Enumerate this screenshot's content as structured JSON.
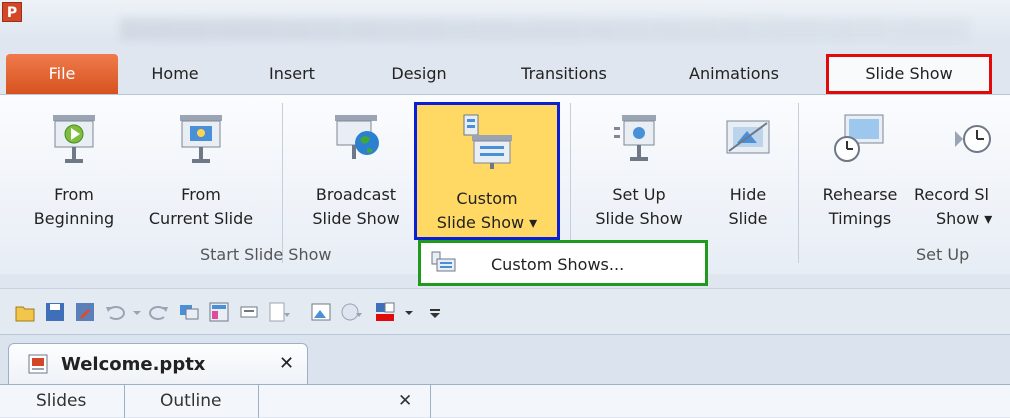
{
  "app": {
    "icon_letter": "P"
  },
  "tabs": [
    {
      "label": "File"
    },
    {
      "label": "Home"
    },
    {
      "label": "Insert"
    },
    {
      "label": "Design"
    },
    {
      "label": "Transitions"
    },
    {
      "label": "Animations"
    },
    {
      "label": "Slide Show"
    }
  ],
  "ribbon": {
    "buttons": [
      {
        "line1": "From",
        "line2": "Beginning"
      },
      {
        "line1": "From",
        "line2": "Current Slide"
      },
      {
        "line1": "Broadcast",
        "line2": "Slide Show"
      },
      {
        "line1": "Custom",
        "line2": "Slide Show ▾"
      },
      {
        "line1": "Set Up",
        "line2": "Slide Show"
      },
      {
        "line1": "Hide",
        "line2": "Slide"
      },
      {
        "line1": "Rehearse",
        "line2": "Timings"
      },
      {
        "line1": "Record Sl",
        "line2": "Show ▾"
      }
    ],
    "groups": {
      "start": "Start Slide Show",
      "setup": "Set Up"
    }
  },
  "dropdown": {
    "item": "Custom Shows..."
  },
  "document_tab": {
    "name": "Welcome.pptx",
    "close": "✕"
  },
  "panes": {
    "slides": "Slides",
    "outline": "Outline",
    "close": "✕"
  },
  "colors": {
    "file_tab": "#d6531f",
    "active_tab_outline": "#e00a0a",
    "custom_highlight_outline": "#0a1fd8",
    "dropdown_outline": "#1f9a1f",
    "custom_button_fill": "#ffd964"
  }
}
